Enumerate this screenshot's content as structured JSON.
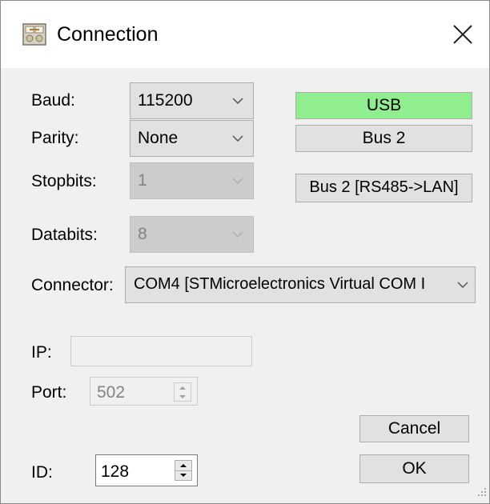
{
  "window": {
    "title": "Connection",
    "close_icon": "close-icon",
    "app_icon": "connection-app-icon"
  },
  "form": {
    "baud": {
      "label": "Baud:",
      "value": "115200"
    },
    "parity": {
      "label": "Parity:",
      "value": "None"
    },
    "stopbits": {
      "label": "Stopbits:",
      "value": "1"
    },
    "databits": {
      "label": "Databits:",
      "value": "8"
    },
    "connector": {
      "label": "Connector:",
      "value": "COM4 [STMicroelectronics Virtual COM I"
    },
    "ip": {
      "label": "IP:",
      "value": ""
    },
    "port": {
      "label": "Port:",
      "value": "502"
    },
    "id": {
      "label": "ID:",
      "value": "128"
    }
  },
  "buttons": {
    "usb": "USB",
    "bus2": "Bus 2",
    "bus2_lan": "Bus 2 [RS485->LAN]",
    "cancel": "Cancel",
    "ok": "OK"
  },
  "colors": {
    "usb_active": "#90ee90",
    "background": "#f0f0f0",
    "button": "#e1e1e1"
  }
}
